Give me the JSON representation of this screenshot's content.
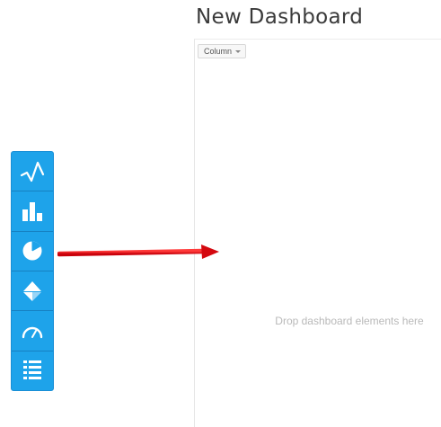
{
  "dashboard": {
    "title": "New Dashboard",
    "layout_selector": "Column",
    "drop_hint": "Drop dashboard elements here"
  },
  "toolbar": {
    "items": [
      {
        "name": "line-chart",
        "icon": "line-chart-icon"
      },
      {
        "name": "bar-chart",
        "icon": "bar-chart-icon"
      },
      {
        "name": "pie-chart",
        "icon": "pie-chart-icon"
      },
      {
        "name": "funnel-chart",
        "icon": "funnel-chart-icon"
      },
      {
        "name": "gauge",
        "icon": "gauge-icon"
      },
      {
        "name": "list",
        "icon": "list-icon"
      }
    ]
  },
  "colors": {
    "toolbar_bg": "#1ea3ea",
    "toolbar_border": "#1a8fd6",
    "arrow": "#e8141a",
    "hint_text": "#b9b9b9"
  }
}
